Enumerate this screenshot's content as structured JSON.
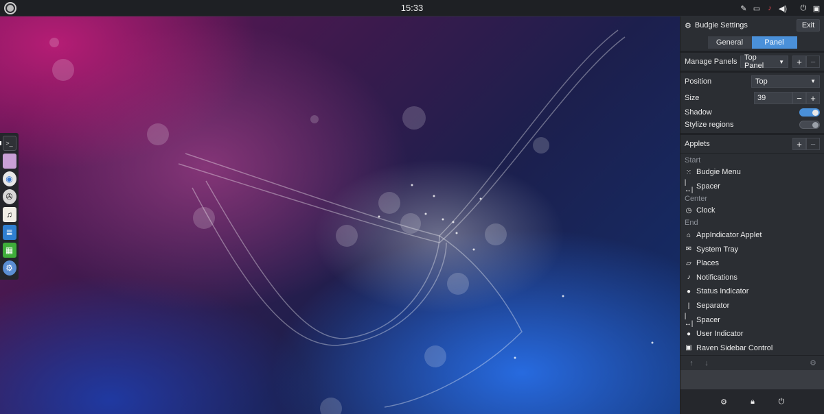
{
  "top_panel": {
    "clock": "15:33",
    "tray_icons": [
      "appindicator-icon",
      "places-icon",
      "notifications-icon",
      "volume-icon",
      "power-icon",
      "raven-icon"
    ]
  },
  "dock": {
    "apps": [
      "terminal-icon",
      "files-icon",
      "web-browser-icon",
      "software-icon",
      "music-icon",
      "writer-icon",
      "calc-icon",
      "settings-app-icon"
    ]
  },
  "settings": {
    "title": "Budgie Settings",
    "exit_label": "Exit",
    "tabs": [
      {
        "label": "General"
      },
      {
        "label": "Panel"
      }
    ],
    "manage_panels_label": "Manage Panels",
    "panel_select": "Top Panel",
    "position_label": "Position",
    "position_value": "Top",
    "size_label": "Size",
    "size_value": "39",
    "shadow_label": "Shadow",
    "shadow_on": true,
    "stylize_label": "Stylize regions",
    "stylize_on": false,
    "applets_label": "Applets",
    "sections": {
      "start": "Start",
      "center": "Center",
      "end": "End"
    },
    "start_applets": [
      {
        "label": "Budgie Menu",
        "icon": "grid-icon"
      },
      {
        "label": "Spacer",
        "icon": "spacer-icon"
      }
    ],
    "center_applets": [
      {
        "label": "Clock",
        "icon": "clock-icon"
      }
    ],
    "end_applets": [
      {
        "label": "AppIndicator Applet",
        "icon": "home-icon"
      },
      {
        "label": "System Tray",
        "icon": "envelope-icon"
      },
      {
        "label": "Places",
        "icon": "places-icon"
      },
      {
        "label": "Notifications",
        "icon": "bell-icon"
      },
      {
        "label": "Status Indicator",
        "icon": "person-icon"
      },
      {
        "label": "Separator",
        "icon": "separator-icon"
      },
      {
        "label": "Spacer",
        "icon": "spacer-icon"
      },
      {
        "label": "User Indicator",
        "icon": "user-icon"
      },
      {
        "label": "Raven Sidebar Control",
        "icon": "raven-icon"
      }
    ]
  },
  "raven_footer": {
    "icons": [
      "settings-icon",
      "lock-icon",
      "power-icon"
    ]
  }
}
